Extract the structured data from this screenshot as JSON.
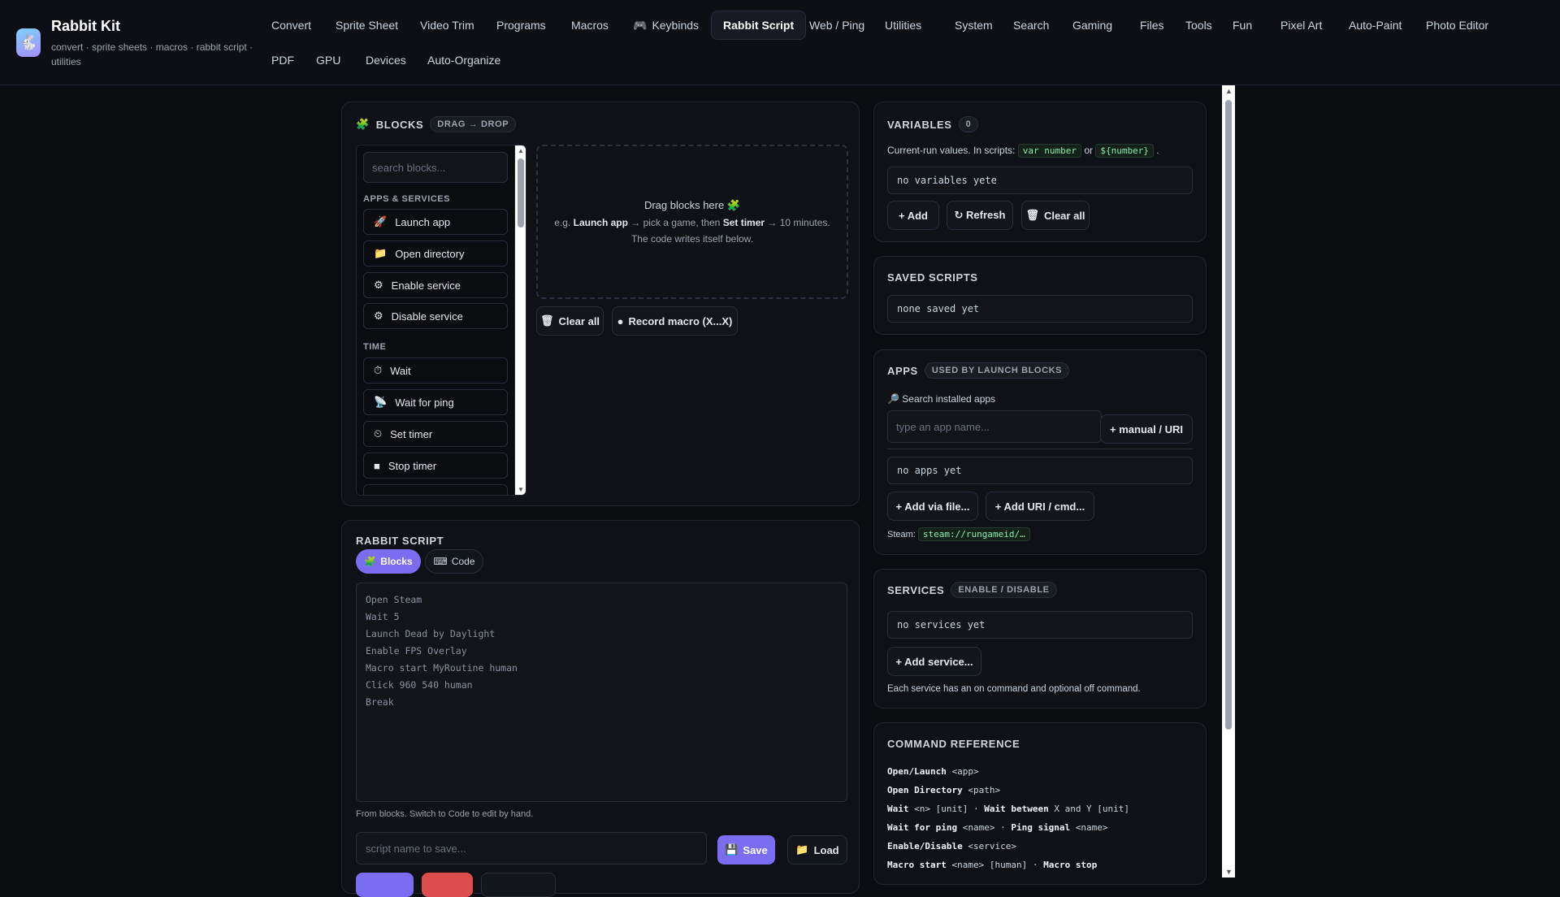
{
  "app": {
    "title": "Rabbit Kit",
    "subtitle": "convert · sprite sheets · macros · rabbit script · utilities",
    "logo_icon": "🐇"
  },
  "nav": {
    "row1": [
      "Convert",
      "Sprite Sheet",
      "Video Trim",
      "Programs",
      "Macros",
      "Keybinds",
      "Rabbit Script",
      "Web / Ping",
      "Utilities",
      "System",
      "Search",
      "Gaming",
      "Files",
      "Tools",
      "Fun",
      "Pixel Art",
      "Auto-Paint",
      "Photo Editor"
    ],
    "row2": [
      "PDF",
      "GPU",
      "Devices",
      "Auto-Organize"
    ],
    "active": "Rabbit Script",
    "keybinds_icon": "🎮"
  },
  "blocks": {
    "title": "BLOCKS",
    "badge": "DRAG → DROP",
    "icon": "🧩",
    "search_placeholder": "search blocks...",
    "groups": [
      {
        "label": "APPS & SERVICES",
        "items": [
          {
            "icon": "🚀",
            "label": "Launch app"
          },
          {
            "icon": "📁",
            "label": "Open directory"
          },
          {
            "icon": "⚙",
            "label": "Enable service"
          },
          {
            "icon": "⚙",
            "label": "Disable service"
          }
        ]
      },
      {
        "label": "TIME",
        "items": [
          {
            "icon": "⏱",
            "label": "Wait"
          },
          {
            "icon": "📡",
            "label": "Wait for ping"
          },
          {
            "icon": "⏲",
            "label": "Set timer"
          },
          {
            "icon": "■",
            "label": "Stop timer"
          }
        ]
      }
    ],
    "drop": {
      "title": "Drag blocks here",
      "title_icon": "🧩",
      "hint_pre": "e.g. ",
      "hint_b1": "Launch app",
      "hint_mid": " → pick a game, then ",
      "hint_b2": "Set timer",
      "hint_post": " → 10 minutes.",
      "hint2": "The code writes itself below."
    },
    "clear_label": "Clear all",
    "record_label": "Record macro (X...X)"
  },
  "script": {
    "title": "RABBIT SCRIPT",
    "tab_blocks": "Blocks",
    "tab_code": "Code",
    "tab_blocks_icon": "🧩",
    "tab_code_icon": "⌨",
    "lines": [
      "Open Steam",
      "Wait 5",
      "Launch Dead by Daylight",
      "Enable FPS Overlay",
      "Macro start MyRoutine human",
      "Click 960 540 human",
      "Break"
    ],
    "note": "From blocks. Switch to Code to edit by hand.",
    "name_placeholder": "script name to save...",
    "save_label": "Save",
    "load_label": "Load",
    "save_icon": "💾",
    "load_icon": "📁"
  },
  "variables": {
    "title": "VARIABLES",
    "count": "0",
    "desc_pre": "Current-run values. In scripts:",
    "code1": "var number",
    "desc_or": "or",
    "code2": "${number}",
    "desc_end": ".",
    "empty": "no variables yete",
    "add": "+ Add",
    "refresh": "↻ Refresh",
    "clear": "Clear all"
  },
  "saved": {
    "title": "SAVED SCRIPTS",
    "empty": "none saved yet"
  },
  "apps": {
    "title": "APPS",
    "badge": "USED BY LAUNCH BLOCKS",
    "search_label": "Search installed apps",
    "search_icon": "🔎",
    "input_placeholder": "type an app name...",
    "manual": "+ manual / URI",
    "empty": "no apps yet",
    "add_file": "+ Add via file...",
    "add_uri": "+ Add URI / cmd...",
    "steam_label": "Steam:",
    "steam_code": "steam://rungameid/…"
  },
  "services": {
    "title": "SERVICES",
    "badge": "ENABLE / DISABLE",
    "empty": "no services yet",
    "add": "+ Add service...",
    "desc": "Each service has an on command and optional off command."
  },
  "reference": {
    "title": "COMMAND REFERENCE",
    "lines": [
      [
        {
          "t": "Open/Launch",
          "b": true
        },
        {
          "t": " <app>"
        }
      ],
      [
        {
          "t": "Open Directory",
          "b": true
        },
        {
          "t": " <path>"
        }
      ],
      [
        {
          "t": "Wait",
          "b": true
        },
        {
          "t": " <n> [unit] · "
        },
        {
          "t": "Wait between",
          "b": true
        },
        {
          "t": " X and Y [unit]"
        }
      ],
      [
        {
          "t": "Wait for ping",
          "b": true
        },
        {
          "t": " <name> · "
        },
        {
          "t": "Ping signal",
          "b": true
        },
        {
          "t": " <name>"
        }
      ],
      [
        {
          "t": "Enable/Disable",
          "b": true
        },
        {
          "t": " <service>"
        }
      ],
      [
        {
          "t": "Macro start",
          "b": true
        },
        {
          "t": " <name> [human] · "
        },
        {
          "t": "Macro stop",
          "b": true
        }
      ]
    ]
  }
}
